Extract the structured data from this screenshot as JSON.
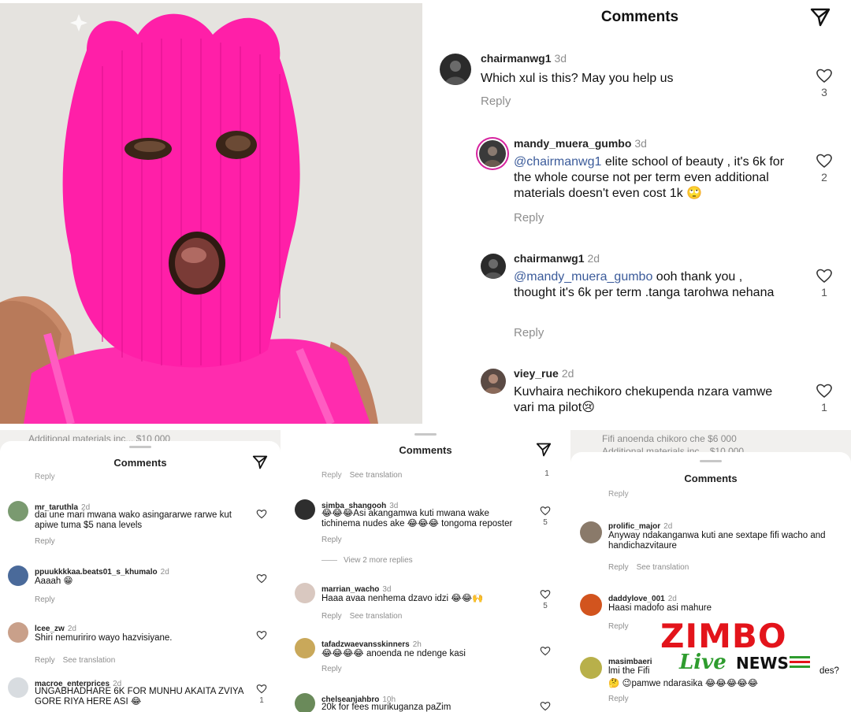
{
  "main": {
    "title": "Comments",
    "comments": [
      {
        "username": "chairmanwg1",
        "age": "3d",
        "text": "Which xul is this?  May you  help us",
        "reply": "Reply",
        "likes": "3"
      },
      {
        "username": "mandy_muera_gumbo",
        "age": "3d",
        "mention": "@chairmanwg1",
        "text": " elite school of beauty , it's 6k for the whole course not per term even additional materials doesn't even cost 1k 🙄",
        "reply": "Reply",
        "likes": "2"
      },
      {
        "username": "chairmanwg1",
        "age": "2d",
        "mention": "@mandy_muera_gumbo",
        "text": " ooh thank you , thought  it's 6k per term .tanga tarohwa nehana",
        "reply": "Reply",
        "likes": "1"
      },
      {
        "username": "viey_rue",
        "age": "2d",
        "text": "Kuvhaira nechikoro chekupenda nzara vamwe vari ma pilot😢",
        "likes": "1"
      }
    ]
  },
  "panel_a": {
    "title": "Comments",
    "behind_text": "Additional materials inc... $10 000",
    "cut_reply": "Reply",
    "comments": [
      {
        "username": "mr_taruthla",
        "age": "2d",
        "text": "dai une mari mwana wako asingararwe rarwe kut apiwe tuma $5 nana levels",
        "reply": "Reply"
      },
      {
        "username": "ppuukkkkaa.beats01_s_khumalo",
        "age": "2d",
        "text": "Aaaah 😁",
        "reply": "Reply"
      },
      {
        "username": "lcee_zw",
        "age": "2d",
        "text": "Shiri nemuririro wayo hazvisiyane.",
        "reply": "Reply",
        "translate": "See translation"
      },
      {
        "username": "macroe_enterprices",
        "age": "2d",
        "text": "UNGABHADHARE 6K FOR MUNHU AKAITA ZVIYA GORE RIYA HERE ASI 😂",
        "likes": "1"
      }
    ]
  },
  "panel_b": {
    "title": "Comments",
    "cut_text": "Reply",
    "cut_translate": "See translation",
    "cut_likes": "1",
    "view_more": "View 2 more replies",
    "comments": [
      {
        "username": "simba_shangooh",
        "age": "3d",
        "text": "😂😂😂Asi akangamwa kuti mwana wake tichinema nudes ake 😂😂😂 tongoma reposter",
        "reply": "Reply",
        "likes": "5"
      },
      {
        "username": "marrian_wacho",
        "age": "3d",
        "text": "Haaa avaa nenhema dzavo idzi 😂😂🙌",
        "reply": "Reply",
        "translate": "See translation",
        "likes": "5"
      },
      {
        "username": "tafadzwaevansskinners",
        "age": "2h",
        "text": "😂😂😂😂 anoenda ne ndenge kasi",
        "reply": "Reply"
      },
      {
        "username": "chelseanjahbro",
        "age": "10h",
        "text": "20k for fees murikuganza paZim"
      }
    ]
  },
  "panel_c": {
    "title": "Comments",
    "behind_text": "Fifi anoenda chikoro che $6 000",
    "behind_text2": "Additional materials inc... $10 000",
    "cut_reply": "Reply",
    "comments": [
      {
        "username": "prolific_major",
        "age": "2d",
        "text": "Anyway ndakanganwa kuti ane sextape fifi wacho and handichazvitaure",
        "reply": "Reply",
        "translate": "See translation"
      },
      {
        "username": "daddylove_001",
        "age": "2d",
        "text": "Haasi madofo asi mahure",
        "reply": "Reply"
      },
      {
        "username": "masimbaeri",
        "text": "lmi the Fifi",
        "text_tail": "des?",
        "text2": "🤔 😉pamwe ndarasika 😂😂😂😂😂",
        "reply": "Reply"
      }
    ]
  },
  "watermark": {
    "brand": "ZIMBO",
    "live": "Live",
    "news": "NEWS"
  },
  "colors": {
    "balaclava": "#ff1fa8",
    "mention": "#3b5b9a",
    "muted": "#8e8e8e",
    "logo_red": "#e3141b",
    "logo_green": "#2e9c2e"
  }
}
